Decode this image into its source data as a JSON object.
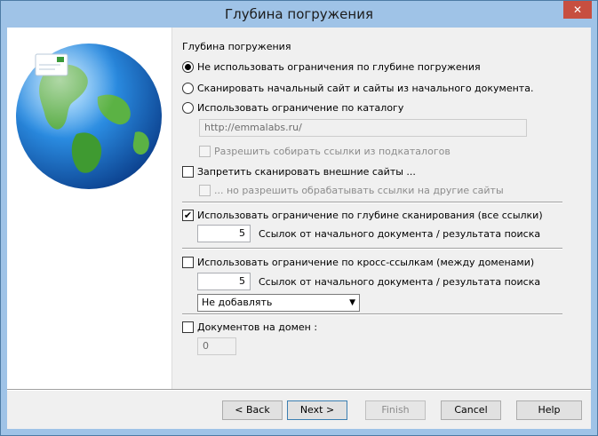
{
  "window": {
    "title": "Глубина погружения",
    "close_glyph": "✕"
  },
  "page": {
    "heading": "Глубина погружения",
    "radio_options": [
      {
        "label": "Не использовать ограничения по глубине погружения",
        "selected": true
      },
      {
        "label": "Сканировать начальный сайт и сайты из начального документа.",
        "selected": false
      },
      {
        "label": "Использовать ограничение по каталогу",
        "selected": false
      }
    ],
    "catalog_url": "http://emmalabs.ru/",
    "allow_subcatalogs": {
      "label": "Разрешить собирать ссылки из подкаталогов",
      "checked": false,
      "disabled": true
    },
    "block_external": {
      "label": "Запретить сканировать внешние сайты ...",
      "checked": false
    },
    "allow_process_links": {
      "label": "... но разрешить обрабатывать ссылки на другие сайты",
      "checked": false,
      "disabled": true
    },
    "scan_depth_limit": {
      "label": "Использовать ограничение по глубине сканирования (все ссылки)",
      "checked": true,
      "value": "5",
      "suffix": "Ссылок от начального документа / результата поиска"
    },
    "cross_links_limit": {
      "label": "Использовать ограничение по кросс-ссылкам (между доменами)",
      "checked": false,
      "value": "5",
      "suffix": "Ссылок от начального документа / результата поиска",
      "select_value": "Не добавлять"
    },
    "docs_per_domain": {
      "label": "Документов на домен :",
      "checked": false,
      "value": "0"
    },
    "checkmark": "✔",
    "dropdown_arrow": "▼"
  },
  "buttons": {
    "back": "< Back",
    "next": "Next >",
    "finish": "Finish",
    "cancel": "Cancel",
    "help": "Help"
  },
  "colors": {
    "titlebar": "#9fc3e7",
    "close": "#c74f40",
    "sidebar": "#ffffff"
  },
  "icons": [
    "globe-illustration",
    "close-icon",
    "chevron-down-icon",
    "checkmark-icon"
  ]
}
